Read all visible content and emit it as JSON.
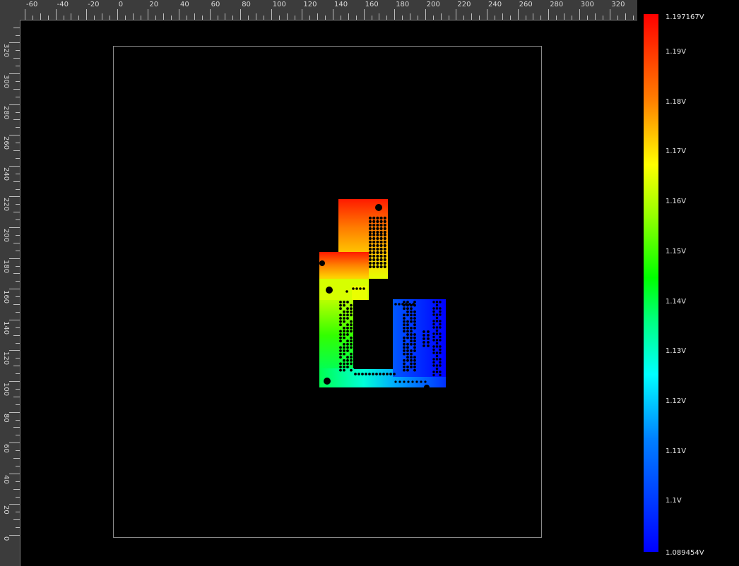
{
  "ruler_top": {
    "labels": [
      "-60",
      "-40",
      "-20",
      "0",
      "20",
      "40",
      "60",
      "80",
      "100",
      "120",
      "140",
      "160",
      "180",
      "200",
      "220",
      "240",
      "260",
      "280",
      "300",
      "320"
    ]
  },
  "ruler_left": {
    "labels": [
      "0",
      "20",
      "40",
      "60",
      "80",
      "100",
      "120",
      "140",
      "160",
      "180",
      "200",
      "220",
      "240",
      "260",
      "280",
      "300",
      "320"
    ]
  },
  "colorbar": {
    "max_label": "1.197167V",
    "min_label": "1.089454V",
    "labels": [
      "1.19V",
      "1.18V",
      "1.17V",
      "1.16V",
      "1.15V",
      "1.14V",
      "1.13V",
      "1.12V",
      "1.11V",
      "1.1V"
    ],
    "colors": {
      "high": "#ff0000",
      "mid": "#00ff00",
      "low": "#0000ff"
    }
  }
}
